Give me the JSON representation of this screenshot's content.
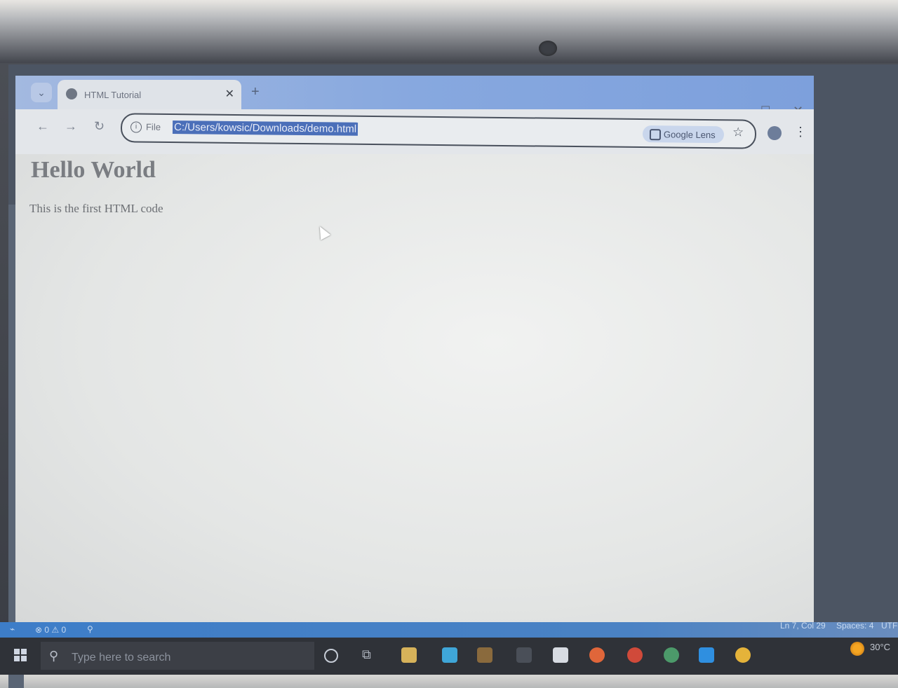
{
  "browser": {
    "tab": {
      "title": "HTML Tutorial"
    },
    "new_tab_label": "+",
    "toolbar": {
      "file_label": "File",
      "url": "C:/Users/kowsic/Downloads/demo.html",
      "lens_label": "Google Lens"
    }
  },
  "page": {
    "heading": "Hello World",
    "paragraph": "This is the first HTML code"
  },
  "statusbar": {
    "problems": "⊗ 0 ⚠ 0",
    "position": "Ln 7, Col 29",
    "spaces": "Spaces: 4",
    "encoding": "UTF-"
  },
  "taskbar": {
    "search_placeholder": "Type here to search",
    "temperature": "30°C"
  },
  "colors": {
    "tabbar": "#87a8df",
    "url_highlight": "#4b6fb9",
    "statusbar": "#3d7dc8",
    "taskbar": "#2f3238"
  }
}
